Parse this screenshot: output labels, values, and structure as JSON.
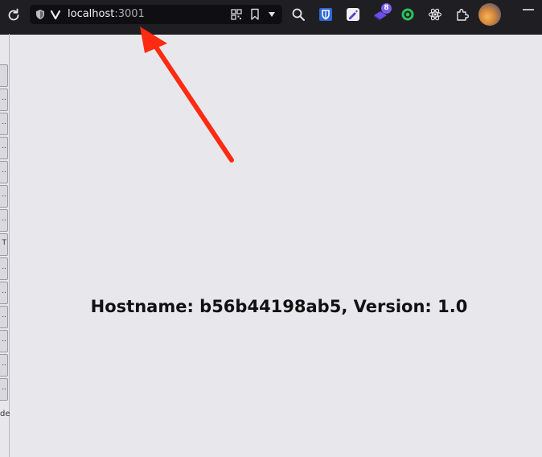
{
  "browser": {
    "url_host": "localhost",
    "url_port": ":3001",
    "extension_badge_count": "8",
    "icons": [
      "reload-icon",
      "shield-icon",
      "vivaldi-logo-icon",
      "qr-code-icon",
      "bookmark-icon",
      "dropdown-icon",
      "search-icon",
      "bitwarden-icon",
      "note-extension-icon",
      "badge-extension-icon",
      "green-extension-icon",
      "react-devtools-icon",
      "extensions-puzzle-icon",
      "avatar",
      "menu-icon"
    ]
  },
  "sidebar": {
    "marks": [
      "",
      "..",
      "..",
      "..",
      "..",
      "..",
      "..",
      "T",
      "..",
      "..",
      "..",
      "..",
      "..",
      ".."
    ],
    "tail_text": "de"
  },
  "main": {
    "message": "Hostname: b56b44198ab5, Version: 1.0"
  },
  "annotation": {
    "arrow_color": "#ff2a12"
  }
}
